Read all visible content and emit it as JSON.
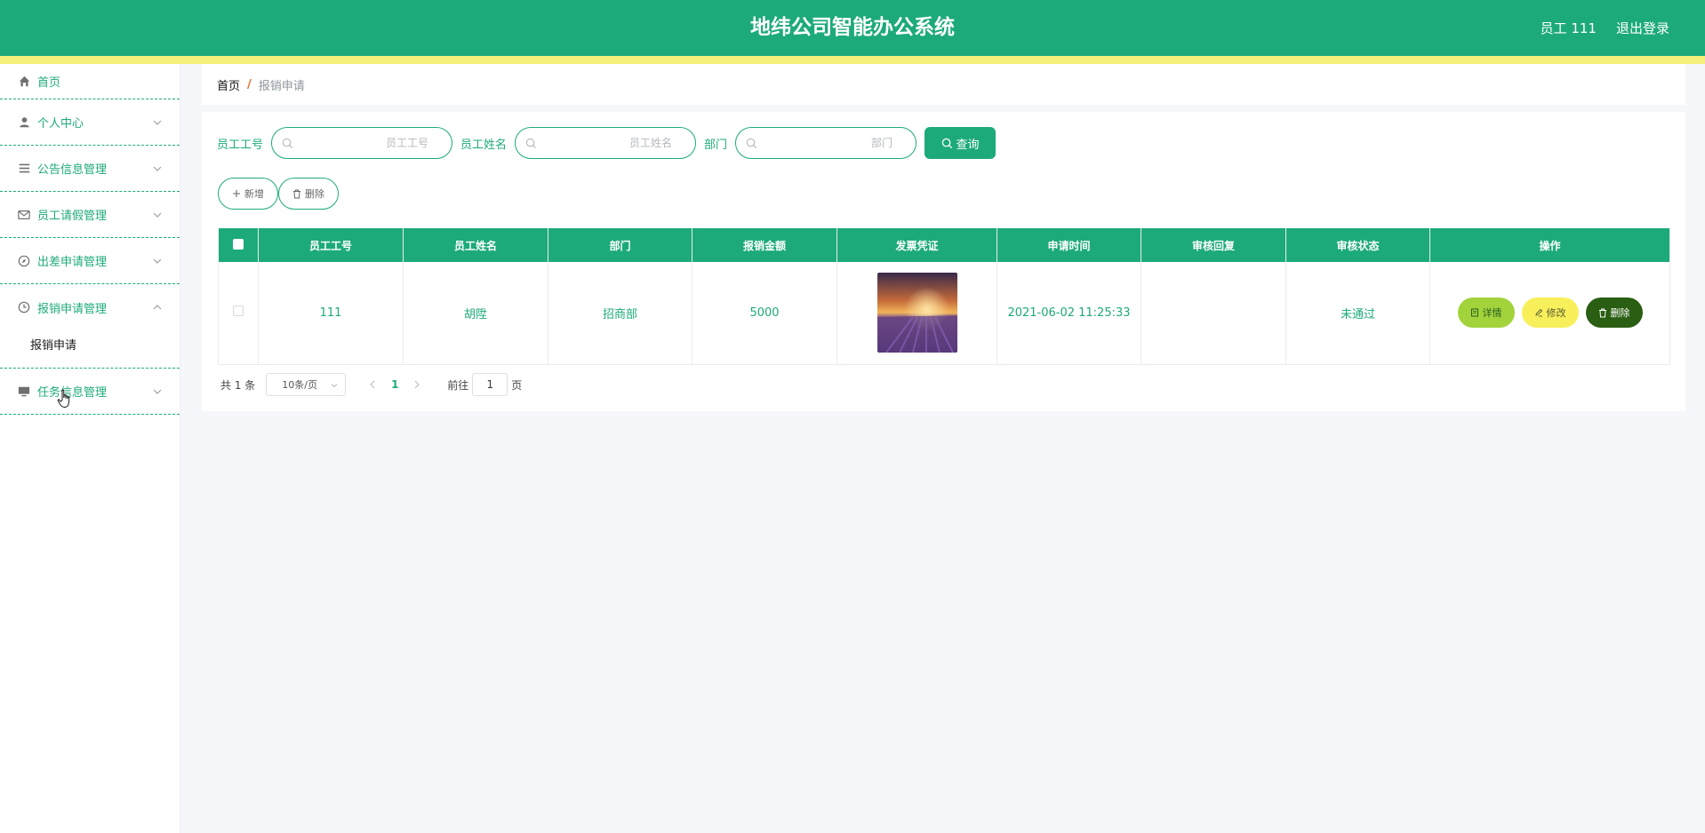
{
  "header": {
    "title": "地纬公司智能办公系统",
    "user_label": "员工 111",
    "logout_label": "退出登录",
    "brand_color": "#1daa7a",
    "stripe_color": "#f5f07a"
  },
  "sidebar": {
    "items": [
      {
        "label": "首页",
        "icon": "home-icon"
      },
      {
        "label": "个人中心",
        "icon": "user-icon"
      },
      {
        "label": "公告信息管理",
        "icon": "list-icon"
      },
      {
        "label": "员工请假管理",
        "icon": "mail-icon"
      },
      {
        "label": "出差申请管理",
        "icon": "compass-icon"
      },
      {
        "label": "报销申请管理",
        "icon": "clock-icon",
        "expanded": true,
        "children": [
          {
            "label": "报销申请"
          }
        ]
      },
      {
        "label": "任务信息管理",
        "icon": "monitor-icon"
      }
    ]
  },
  "breadcrumb": {
    "home": "首页",
    "current": "报销申请"
  },
  "search": {
    "employee_no_label": "员工工号",
    "employee_no_placeholder": "员工工号",
    "employee_name_label": "员工姓名",
    "employee_name_placeholder": "员工姓名",
    "department_label": "部门",
    "department_placeholder": "部门",
    "query_label": "查询"
  },
  "actions": {
    "add_label": "新增",
    "delete_label": "删除"
  },
  "table": {
    "columns": [
      "员工工号",
      "员工姓名",
      "部门",
      "报销金额",
      "发票凭证",
      "申请时间",
      "审核回复",
      "审核状态",
      "操作"
    ],
    "rows": [
      {
        "employee_no": "111",
        "employee_name": "胡陞",
        "department": "招商部",
        "amount": "5000",
        "voucher": "lavender-field-image",
        "apply_time": "2021-06-02 11:25:33",
        "review_reply": "",
        "review_status": "未通过",
        "ops": {
          "detail": "详情",
          "edit": "修改",
          "delete": "删除"
        }
      }
    ]
  },
  "pagination": {
    "total_text": "共 1 条",
    "page_size": "10条/页",
    "current_page": "1",
    "goto_label": "前往",
    "goto_value": "1",
    "page_suffix": "页"
  }
}
